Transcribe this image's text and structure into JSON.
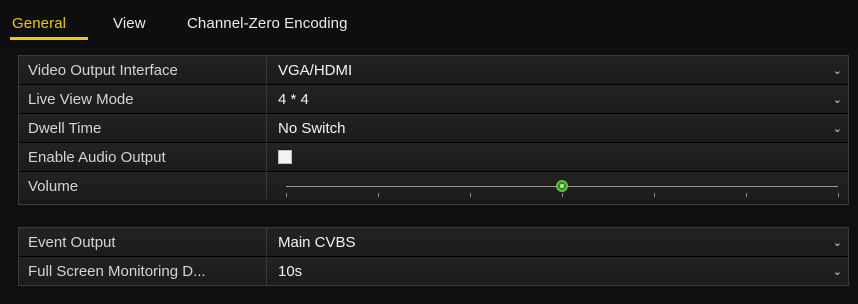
{
  "tabs": [
    {
      "label": "General",
      "active": true
    },
    {
      "label": "View",
      "active": false
    },
    {
      "label": "Channel-Zero Encoding",
      "active": false
    }
  ],
  "colors": {
    "accent": "#f0c800",
    "slider_knob": "#2e8a22"
  },
  "general": {
    "rows": [
      {
        "label": "Video Output Interface",
        "value": "VGA/HDMI",
        "control": "select"
      },
      {
        "label": "Live View Mode",
        "value": "4 * 4",
        "control": "select"
      },
      {
        "label": "Dwell Time",
        "value": "No Switch",
        "control": "select"
      },
      {
        "label": "Enable Audio Output",
        "checked": false,
        "control": "checkbox"
      },
      {
        "label": "Volume",
        "level_fraction": 0.5,
        "control": "slider",
        "tick_count": 7
      }
    ]
  },
  "output": {
    "rows": [
      {
        "label": "Event Output",
        "value": "Main CVBS",
        "control": "select"
      },
      {
        "label": "Full Screen Monitoring D...",
        "value": "10s",
        "control": "select"
      }
    ]
  },
  "icons": {
    "dropdown": "chevron-down-icon",
    "slider": "slider-knob-icon"
  }
}
